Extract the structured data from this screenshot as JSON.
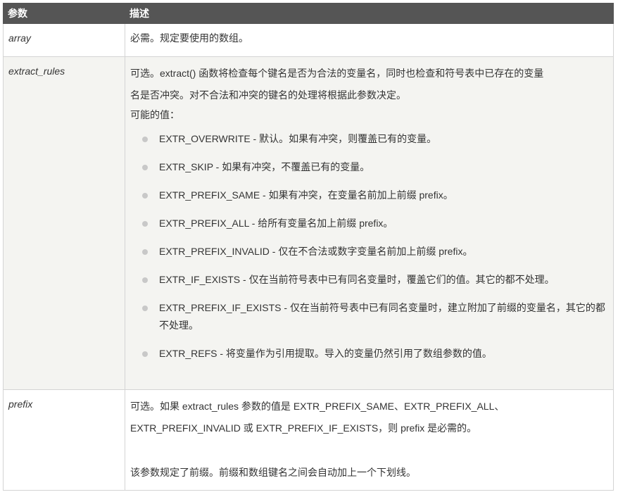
{
  "header": {
    "col_param": "参数",
    "col_desc": "描述"
  },
  "rows": {
    "array": {
      "name": "array",
      "desc": "必需。规定要使用的数组。"
    },
    "extract_rules": {
      "name": "extract_rules",
      "desc_line1": "可选。extract() 函数将检查每个键名是否为合法的变量名，同时也检查和符号表中已存在的变量",
      "desc_line2": "名是否冲突。对不合法和冲突的键名的处理将根据此参数决定。",
      "possible_values_label": "可能的值：",
      "options": [
        "EXTR_OVERWRITE - 默认。如果有冲突，则覆盖已有的变量。",
        "EXTR_SKIP - 如果有冲突，不覆盖已有的变量。",
        "EXTR_PREFIX_SAME - 如果有冲突，在变量名前加上前缀 prefix。",
        "EXTR_PREFIX_ALL - 给所有变量名加上前缀 prefix。",
        "EXTR_PREFIX_INVALID - 仅在不合法或数字变量名前加上前缀 prefix。",
        "EXTR_IF_EXISTS - 仅在当前符号表中已有同名变量时，覆盖它们的值。其它的都不处理。",
        "EXTR_PREFIX_IF_EXISTS - 仅在当前符号表中已有同名变量时，建立附加了前缀的变量名，其它的都不处理。",
        "EXTR_REFS - 将变量作为引用提取。导入的变量仍然引用了数组参数的值。"
      ]
    },
    "prefix": {
      "name": "prefix",
      "desc_line1": "可选。如果 extract_rules 参数的值是 EXTR_PREFIX_SAME、EXTR_PREFIX_ALL、",
      "desc_line2": "EXTR_PREFIX_INVALID 或 EXTR_PREFIX_IF_EXISTS，则 prefix 是必需的。",
      "desc_note": "该参数规定了前缀。前缀和数组键名之间会自动加上一个下划线。"
    }
  }
}
